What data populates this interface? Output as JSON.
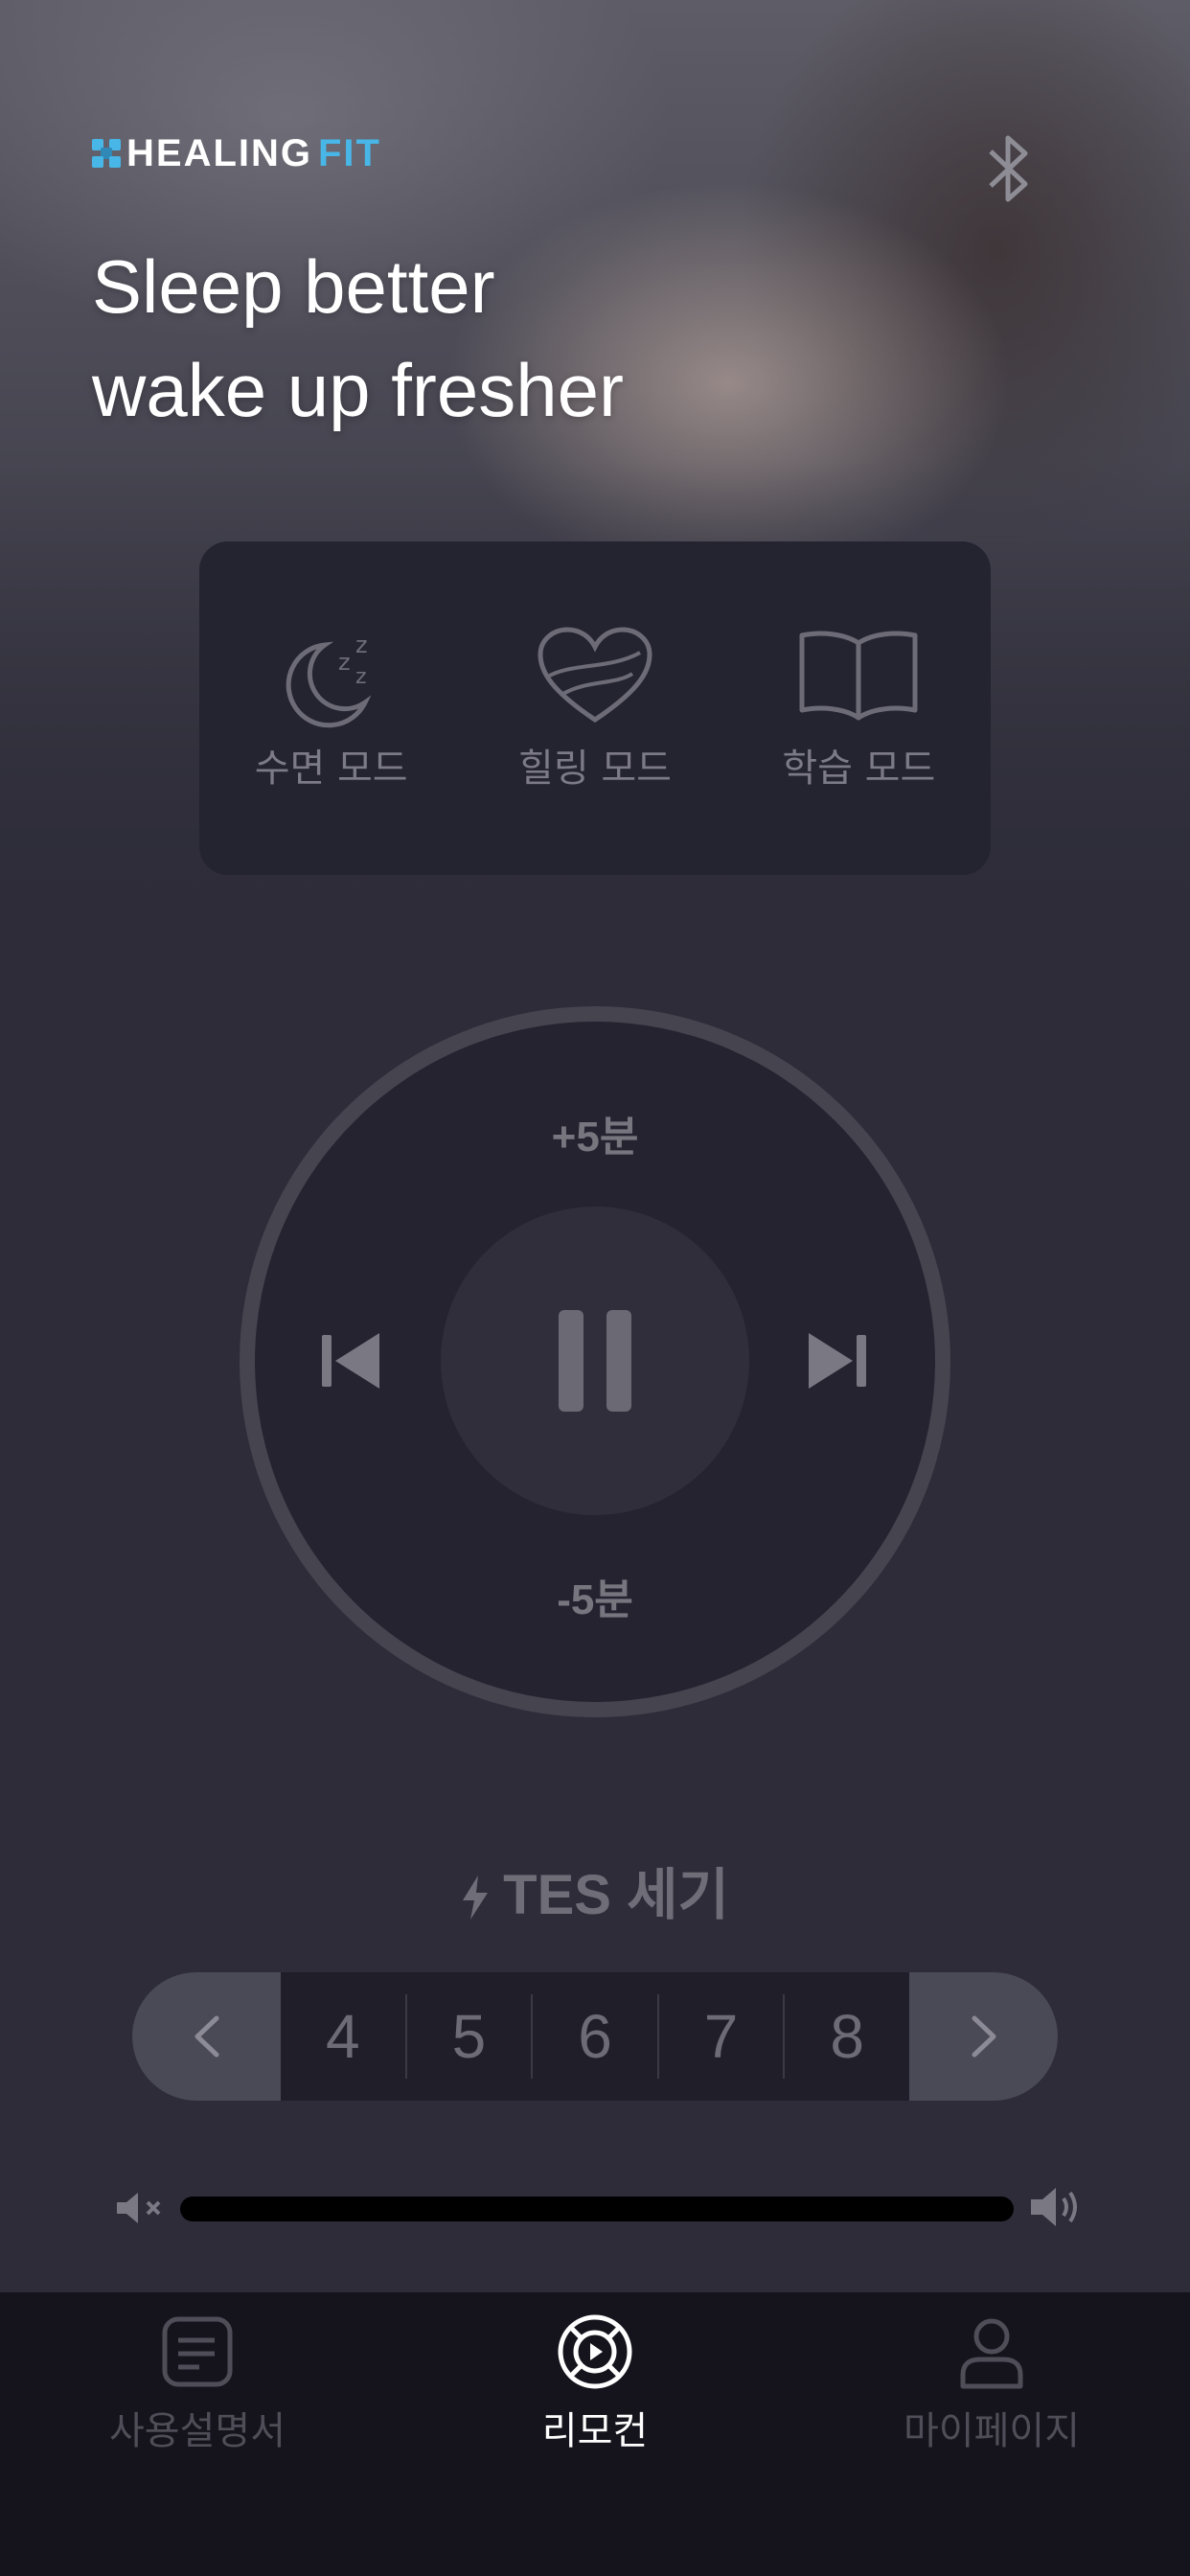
{
  "brand": {
    "logo_part1": "HEALING",
    "logo_part2": "FIT"
  },
  "header": {
    "headline_line1": "Sleep better",
    "headline_line2": "wake up fresher",
    "bluetooth_icon": "bluetooth-icon"
  },
  "modes": [
    {
      "label": "수면 모드",
      "icon": "moon-sleep-icon"
    },
    {
      "label": "힐링 모드",
      "icon": "heart-icon"
    },
    {
      "label": "학습 모드",
      "icon": "book-icon"
    }
  ],
  "dial": {
    "plus_label": "+5분",
    "minus_label": "-5분",
    "state": "playing"
  },
  "tes": {
    "title": "TES 세기",
    "values": [
      "4",
      "5",
      "6",
      "7",
      "8"
    ]
  },
  "volume": {
    "level": 1.0
  },
  "tabs": [
    {
      "label": "사용설명서",
      "icon": "manual-icon",
      "active": false
    },
    {
      "label": "리모컨",
      "icon": "remote-control-icon",
      "active": true
    },
    {
      "label": "마이페이지",
      "icon": "user-icon",
      "active": false
    }
  ],
  "colors": {
    "background": "#2d2c38",
    "accent": "#48b6e6",
    "active_tab": "#ffffff",
    "inactive": "#4e4d58"
  }
}
